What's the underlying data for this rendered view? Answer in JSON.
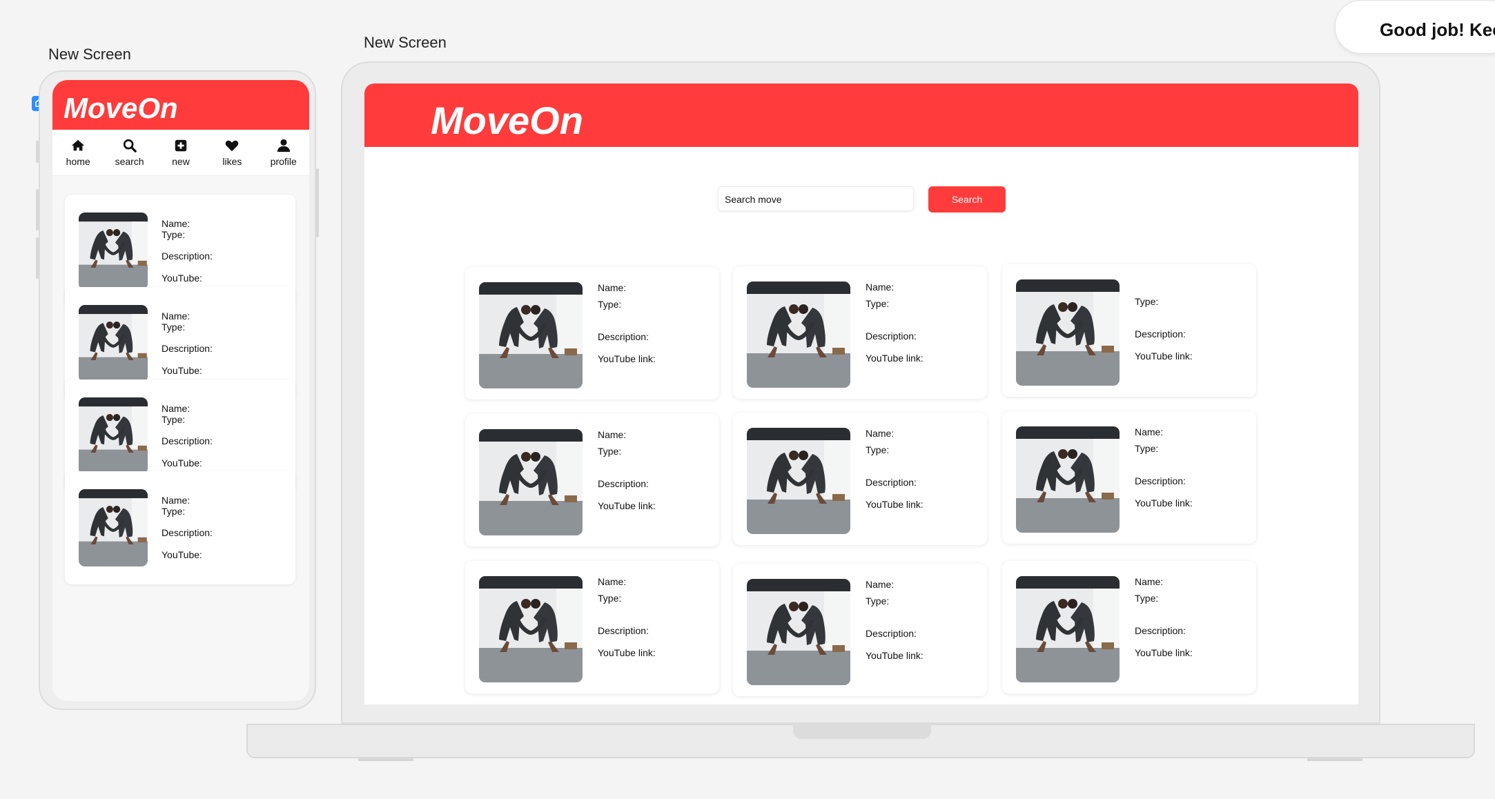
{
  "toast": {
    "text": "Good job! Keep"
  },
  "tablet": {
    "frame_label": "New Screen",
    "logo": "MoveOn",
    "nav": [
      {
        "label": "home",
        "icon": "home-icon"
      },
      {
        "label": "search",
        "icon": "search-icon"
      },
      {
        "label": "new",
        "icon": "plus-square-icon"
      },
      {
        "label": "likes",
        "icon": "heart-icon"
      },
      {
        "label": "profile",
        "icon": "user-icon"
      }
    ],
    "card_fields": {
      "name": "Name:",
      "type": "Type:",
      "description": "Description:",
      "youtube": "YouTube:"
    }
  },
  "desktop": {
    "frame_label": "New Screen",
    "logo": "MoveOn",
    "search": {
      "placeholder": "Search move",
      "button": "Search"
    },
    "card_fields": {
      "name": "Name:",
      "type": "Type:",
      "description": "Description:",
      "youtube": "YouTube link:"
    }
  },
  "colors": {
    "brand": "#ff3b3b",
    "selection": "#2f8cff"
  }
}
